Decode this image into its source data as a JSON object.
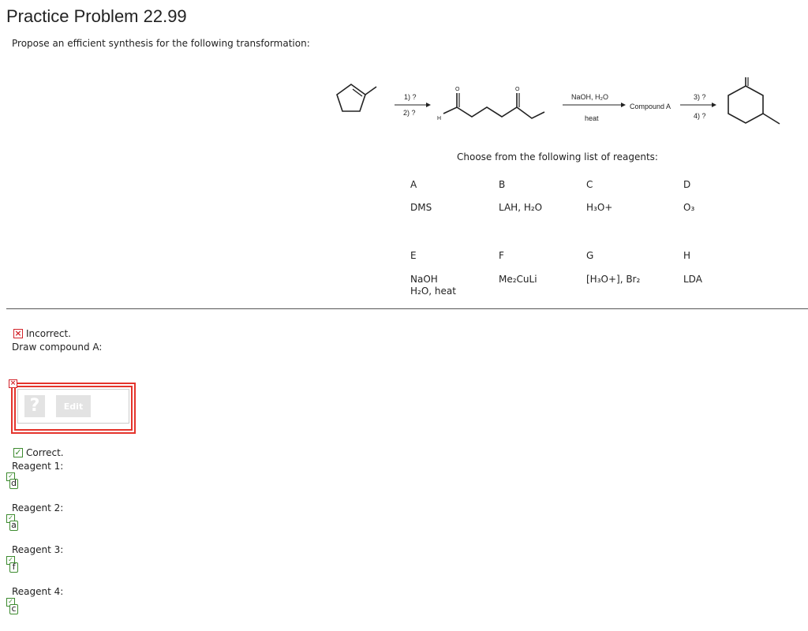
{
  "title": "Practice Problem 22.99",
  "prompt": "Propose an efficient synthesis for the following transformation:",
  "scheme": {
    "step1": "1) ?",
    "step2": "2) ?",
    "h_label": "H",
    "o_label": "O",
    "cond_top": "NaOH, H₂O",
    "cond_bottom": "heat",
    "compound": "Compound A",
    "step3": "3) ?",
    "step4": "4) ?"
  },
  "choose_text": "Choose from the following list of reagents:",
  "reagents": [
    {
      "letter": "A",
      "name": "DMS",
      "name2": ""
    },
    {
      "letter": "B",
      "name": "LAH, H₂O",
      "name2": ""
    },
    {
      "letter": "C",
      "name": "H₃O+",
      "name2": ""
    },
    {
      "letter": "D",
      "name": "O₃",
      "name2": ""
    },
    {
      "letter": "E",
      "name": "NaOH",
      "name2": "H₂O, heat"
    },
    {
      "letter": "F",
      "name": "Me₂CuLi",
      "name2": ""
    },
    {
      "letter": "G",
      "name": "[H₃O+], Br₂",
      "name2": ""
    },
    {
      "letter": "H",
      "name": "LDA",
      "name2": ""
    }
  ],
  "incorrect": {
    "icon": "x-mark-icon",
    "label": "Incorrect.",
    "question": "Draw compound A:"
  },
  "editor": {
    "placeholder_symbol": "?",
    "edit_label": "Edit"
  },
  "correct": {
    "icon": "checkmark-icon",
    "label": "Correct."
  },
  "answers": [
    {
      "label": "Reagent 1:",
      "value": "d"
    },
    {
      "label": "Reagent 2:",
      "value": "a"
    },
    {
      "label": "Reagent 3:",
      "value": "f"
    },
    {
      "label": "Reagent 4:",
      "value": "c"
    }
  ],
  "colors": {
    "error": "#d2232a",
    "success": "#3c8a2e",
    "text": "#222222",
    "disabled": "#e3e3e3"
  }
}
